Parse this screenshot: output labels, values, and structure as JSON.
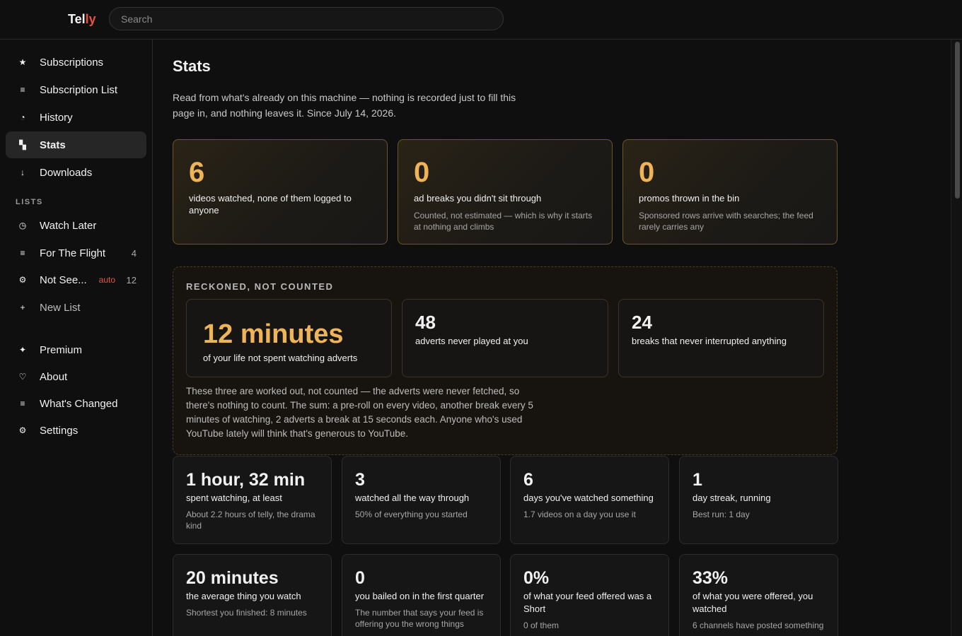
{
  "app": {
    "logo_main": "Tel",
    "logo_accent": "ly",
    "search_placeholder": "Search"
  },
  "sidebar": {
    "items": [
      {
        "label": "Subscriptions",
        "icon": "star-icon",
        "glyph": "★"
      },
      {
        "label": "Subscription List",
        "icon": "list-icon",
        "glyph": "≡"
      },
      {
        "label": "History",
        "icon": "clock-icon",
        "glyph": "◔"
      },
      {
        "label": "Stats",
        "icon": "bar-chart-icon",
        "glyph": "▚",
        "active": true
      },
      {
        "label": "Downloads",
        "icon": "download-arrow-icon",
        "glyph": "↓"
      }
    ],
    "lists_label": "LISTS",
    "lists": [
      {
        "label": "Watch Later",
        "icon": "clock-icon",
        "glyph": "◷"
      },
      {
        "label": "For The Flight",
        "icon": "list-icon",
        "glyph": "≡",
        "count": "4"
      },
      {
        "label": "Not See...",
        "icon": "gear-icon",
        "glyph": "⚙",
        "badge": "auto",
        "count": "12"
      },
      {
        "label": "New List",
        "icon": "plus-icon",
        "glyph": "+"
      }
    ],
    "footer": [
      {
        "label": "Premium",
        "icon": "sparkle-icon",
        "glyph": "✦"
      },
      {
        "label": "About",
        "icon": "heart-icon",
        "glyph": "♡"
      },
      {
        "label": "What's Changed",
        "icon": "list-icon",
        "glyph": "≡"
      },
      {
        "label": "Settings",
        "icon": "gear-icon",
        "glyph": "⚙"
      }
    ]
  },
  "main": {
    "title": "Stats",
    "intro": "Read from what's already on this machine — nothing is recorded just to fill this page in, and nothing leaves it. Since July 14, 2026.",
    "hero": [
      {
        "value": "6",
        "label": "videos watched, none of them logged to anyone",
        "note": ""
      },
      {
        "value": "0",
        "label": "ad breaks you didn't sit through",
        "note": "Counted, not estimated — which is why it starts at nothing and climbs"
      },
      {
        "value": "0",
        "label": "promos thrown in the bin",
        "note": "Sponsored rows arrive with searches; the feed rarely carries any"
      }
    ],
    "reckoned": {
      "title": "RECKONED, NOT COUNTED",
      "cards": [
        {
          "value": "12 minutes",
          "label": "of your life not spent watching adverts"
        },
        {
          "value": "48",
          "label": "adverts never played at you"
        },
        {
          "value": "24",
          "label": "breaks that never interrupted anything"
        }
      ],
      "explanation": "These three are worked out, not counted — the adverts were never fetched, so there's nothing to count. The sum: a pre-roll on every video, another break every 5 minutes of watching, 2 adverts a break at 15 seconds each. Anyone who's used YouTube lately will think that's generous to YouTube."
    },
    "stats_row1": [
      {
        "value": "1 hour, 32 min",
        "label": "spent watching, at least",
        "note": "About 2.2 hours of telly, the drama kind"
      },
      {
        "value": "3",
        "label": "watched all the way through",
        "note": "50% of everything you started"
      },
      {
        "value": "6",
        "label": "days you've watched something",
        "note": "1.7 videos on a day you use it"
      },
      {
        "value": "1",
        "label": "day streak, running",
        "note": "Best run: 1 day"
      }
    ],
    "stats_row2": [
      {
        "value": "20 minutes",
        "label": "the average thing you watch",
        "note": "Shortest you finished: 8 minutes"
      },
      {
        "value": "0",
        "label": "you bailed on in the first quarter",
        "note": "The number that says your feed is offering you the wrong things"
      },
      {
        "value": "0%",
        "label": "of what your feed offered was a Short",
        "note": "0 of them"
      },
      {
        "value": "33%",
        "label": "of what you were offered, you watched",
        "note": "6 channels have posted something"
      }
    ]
  },
  "colors": {
    "accent_orange": "#f0b458",
    "brand_red": "#e8533f",
    "background": "#0f0f0f"
  }
}
